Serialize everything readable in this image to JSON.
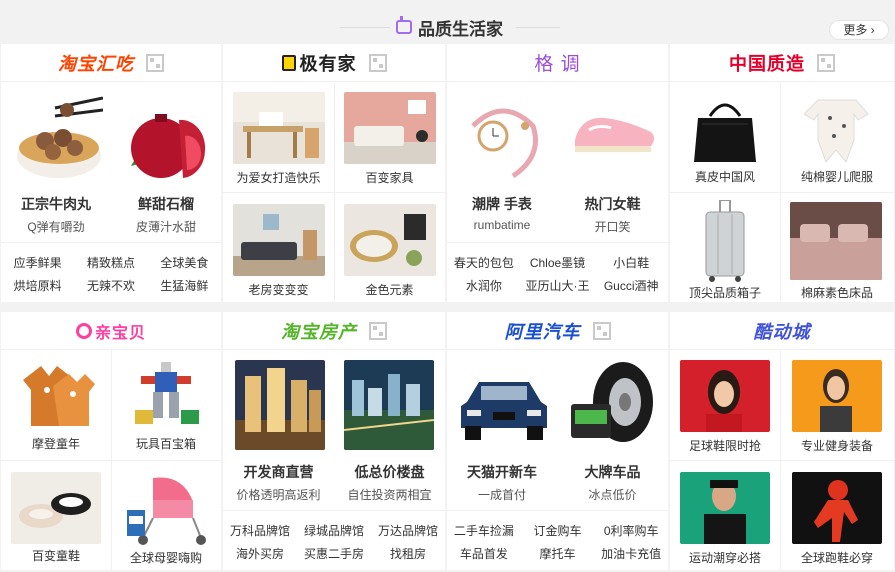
{
  "header": {
    "title": "品质生活家",
    "more": "更多"
  },
  "top": [
    {
      "brand": "淘宝汇吃",
      "color": "#ff4400",
      "items": [
        {
          "title": "正宗牛肉丸",
          "sub": "Q弹有嚼劲"
        },
        {
          "title": "鲜甜石榴",
          "sub": "皮薄汁水甜"
        }
      ],
      "links": [
        "应季鲜果",
        "精致糕点",
        "全球美食",
        "烘培原料",
        "无辣不欢",
        "生猛海鲜"
      ]
    },
    {
      "brand": "极有家",
      "color": "#222222",
      "items": [
        {
          "cap": "为爱女打造快乐"
        },
        {
          "cap": "百变家具"
        },
        {
          "cap": "老房变变变"
        },
        {
          "cap": "金色元素"
        }
      ]
    },
    {
      "brand": "格 调",
      "color": "#9b4dd6",
      "items": [
        {
          "title": "潮牌 手表",
          "sub": "rumbatime"
        },
        {
          "title": "热门女鞋",
          "sub": "开口笑"
        }
      ],
      "links": [
        "春天的包包",
        "Chloe墨镜",
        "小白鞋",
        "水润你",
        "亚历山大·王",
        "Gucci酒神"
      ]
    },
    {
      "brand": "中国质造",
      "color": "#e4002b",
      "items": [
        {
          "cap": "真皮中国风"
        },
        {
          "cap": "纯棉婴儿爬服"
        },
        {
          "cap": "顶尖品质箱子"
        },
        {
          "cap": "棉麻素色床品"
        }
      ]
    }
  ],
  "bottom": [
    {
      "brand": "亲宝贝",
      "color": "#ff3fa0",
      "items": [
        {
          "cap": "摩登童年"
        },
        {
          "cap": "玩具百宝箱"
        },
        {
          "cap": "百变童鞋"
        },
        {
          "cap": "全球母婴嗨购"
        }
      ]
    },
    {
      "brand": "淘宝房产",
      "color": "#55b52a",
      "items": [
        {
          "title": "开发商直营",
          "sub": "价格透明高返利"
        },
        {
          "title": "低总价楼盘",
          "sub": "自住投资两相宜"
        }
      ],
      "links": [
        "万科品牌馆",
        "绿城品牌馆",
        "万达品牌馆",
        "海外买房",
        "买惠二手房",
        "找租房"
      ]
    },
    {
      "brand": "阿里汽车",
      "color": "#1a4fd1",
      "items": [
        {
          "title": "天猫开新车",
          "sub": "一成首付"
        },
        {
          "title": "大牌车品",
          "sub": "冰点低价"
        }
      ],
      "links": [
        "二手车捡漏",
        "订金购车",
        "0利率购车",
        "车品首发",
        "摩托车",
        "加油卡充值"
      ]
    },
    {
      "brand": "酷动城",
      "color": "#4055d9",
      "items": [
        {
          "cap": "足球鞋限时抢"
        },
        {
          "cap": "专业健身装备"
        },
        {
          "cap": "运动潮穿必搭"
        },
        {
          "cap": "全球跑鞋必穿"
        }
      ]
    }
  ]
}
